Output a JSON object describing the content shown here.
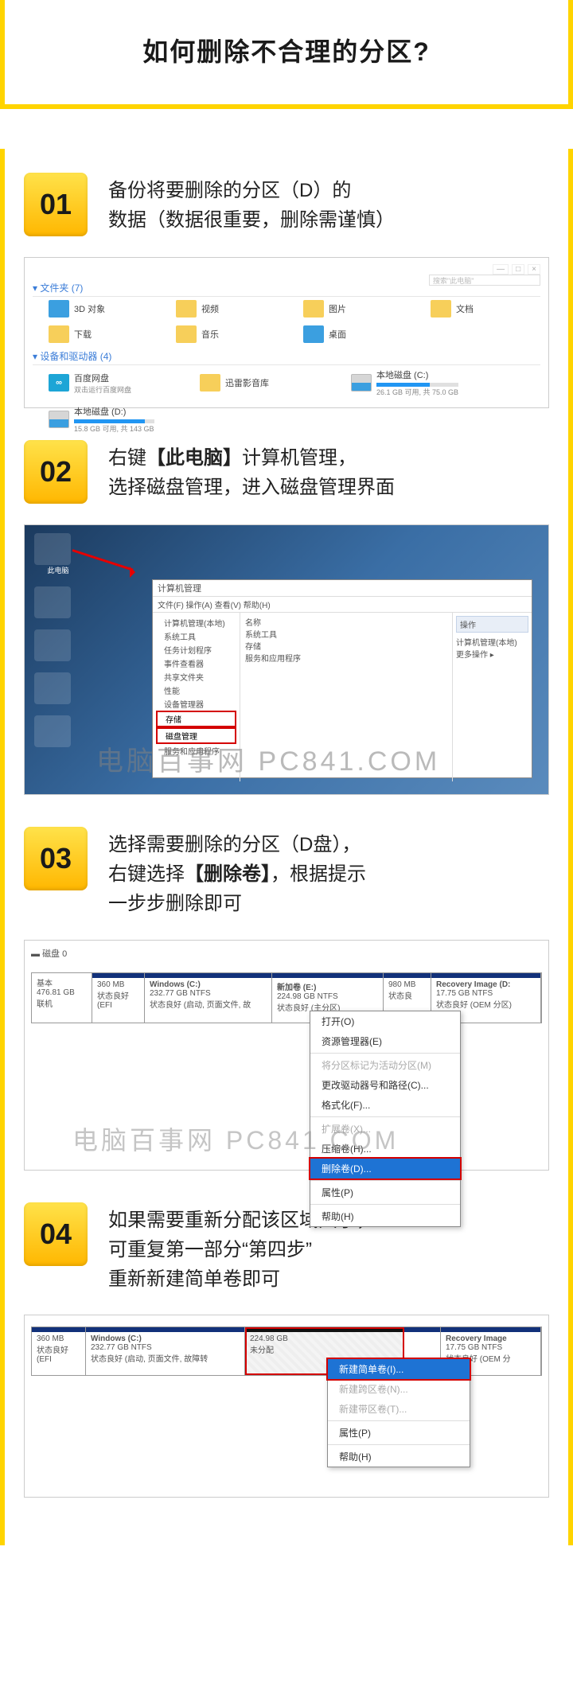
{
  "title": "如何删除不合理的分区?",
  "watermark": "电脑百事网 PC841.COM",
  "steps": {
    "s1": {
      "num": "01",
      "line1": "备份将要删除的分区（D）的",
      "line2": "数据（数据很重要，删除需谨慎）"
    },
    "s2": {
      "num": "02",
      "pre": "右键",
      "bold": "【此电脑】",
      "post": "计算机管理，",
      "line2": "选择磁盘管理，进入磁盘管理界面"
    },
    "s3": {
      "num": "03",
      "line1": "选择需要删除的分区（D盘），",
      "l2pre": "右键选择",
      "l2bold": "【删除卷】",
      "l2post": "，根据提示",
      "line3": "一步步删除即可"
    },
    "s4": {
      "num": "04",
      "line1": "如果需要重新分配该区域大小，",
      "line2": "可重复第一部分“第四步”",
      "line3": "重新新建简单卷即可"
    }
  },
  "explorer": {
    "win_min": "—",
    "win_max": "□",
    "win_close": "×",
    "search_placeholder": "搜索\"此电脑\"",
    "group_folders": "▾ 文件夹 (7)",
    "group_devices": "▾ 设备和驱动器 (4)",
    "folders": {
      "f1": "3D 对象",
      "f2": "视频",
      "f3": "图片",
      "f4": "文档",
      "f5": "下载",
      "f6": "音乐",
      "f7": "桌面"
    },
    "devices": {
      "d1": {
        "name": "百度网盘",
        "sub": "双击运行百度网盘"
      },
      "d2": {
        "name": "迅雷影音库"
      },
      "d3": {
        "name": "本地磁盘 (C:)",
        "sub": "26.1 GB 可用, 共 75.0 GB"
      },
      "d4": {
        "name": "本地磁盘 (D:)",
        "sub": "15.8 GB 可用, 共 143 GB"
      }
    }
  },
  "mgmt": {
    "title": "计算机管理",
    "menu": "文件(F)  操作(A)  查看(V)  帮助(H)",
    "tree": {
      "root": "计算机管理(本地)",
      "t1": "系统工具",
      "t2": "任务计划程序",
      "t3": "事件查看器",
      "t4": "共享文件夹",
      "t5": "性能",
      "t6": "设备管理器",
      "t7": "存储",
      "t8": "磁盘管理",
      "t9": "服务和应用程序"
    },
    "center": {
      "c1": "名称",
      "c2": "系统工具",
      "c3": "存储",
      "c4": "服务和应用程序"
    },
    "side": {
      "hd": "操作",
      "a1": "计算机管理(本地)",
      "a2": "更多操作  ▸"
    }
  },
  "disk": {
    "label": "磁盘 0",
    "info": {
      "type": "基本",
      "size": "476.81 GB",
      "status": "联机"
    },
    "p1": {
      "size": "360 MB",
      "status": "状态良好 (EFI"
    },
    "p2": {
      "name": "Windows  (C:)",
      "size": "232.77 GB NTFS",
      "status": "状态良好 (启动, 页面文件, 故"
    },
    "p3": {
      "name": "新加卷 (E:)",
      "size": "224.98 GB NTFS",
      "status": "状态良好 (主分区)"
    },
    "p4": {
      "size": "980 MB",
      "status": "状态良"
    },
    "p5": {
      "name": "Recovery Image  (D:",
      "size": "17.75 GB NTFS",
      "status": "状态良好 (OEM 分区)"
    }
  },
  "ctx": {
    "m1": "打开(O)",
    "m2": "资源管理器(E)",
    "m3": "将分区标记为活动分区(M)",
    "m4": "更改驱动器号和路径(C)...",
    "m5": "格式化(F)...",
    "m6": "扩展卷(X)...",
    "m7": "压缩卷(H)...",
    "m8": "删除卷(D)...",
    "m9": "属性(P)",
    "m10": "帮助(H)"
  },
  "disk2": {
    "p1": {
      "size": "360 MB",
      "status": "状态良好 (EFI"
    },
    "p2": {
      "name": "Windows  (C:)",
      "size": "232.77 GB NTFS",
      "status": "状态良好 (启动, 页面文件, 故障转"
    },
    "p3": {
      "size": "224.98 GB",
      "status": "未分配"
    },
    "p5": {
      "name": "Recovery Image",
      "size": "17.75 GB NTFS",
      "status": "状态良好 (OEM 分"
    }
  },
  "ctx2": {
    "m1": "新建简单卷(I)...",
    "m2": "新建跨区卷(N)...",
    "m3": "新建带区卷(T)...",
    "m4": "属性(P)",
    "m5": "帮助(H)"
  }
}
